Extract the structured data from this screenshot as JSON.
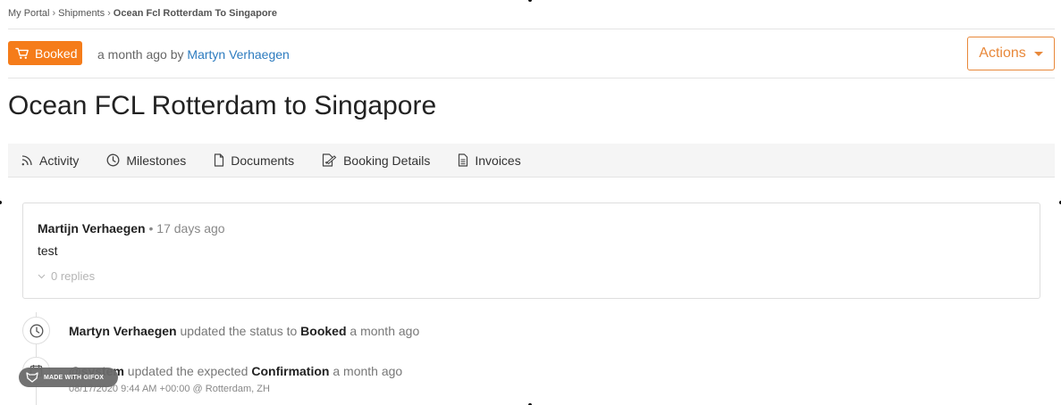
{
  "breadcrumb": {
    "items": [
      "My Portal",
      "Shipments"
    ],
    "separator": "›",
    "current": "Ocean Fcl Rotterdam To Singapore"
  },
  "status": {
    "label": "Booked",
    "icon": "cart-icon",
    "color": "#f57c1a"
  },
  "meta": {
    "prefix": "a month ago by",
    "author": "Martyn Verhaegen"
  },
  "actions": {
    "label": "Actions",
    "color": "#e8883a"
  },
  "title": "Ocean FCL Rotterdam to Singapore",
  "tabs": [
    {
      "label": "Activity",
      "icon": "rss-icon"
    },
    {
      "label": "Milestones",
      "icon": "clock-icon"
    },
    {
      "label": "Documents",
      "icon": "file-icon"
    },
    {
      "label": "Booking Details",
      "icon": "edit-document-icon"
    },
    {
      "label": "Invoices",
      "icon": "invoice-icon"
    }
  ],
  "comment": {
    "author": "Martijn Verhaegen",
    "separator": "•",
    "time": "17 days ago",
    "body": "test",
    "replies": "0 replies"
  },
  "timeline": [
    {
      "icon": "clock-icon",
      "actor": "Martyn Verhaegen",
      "action": "updated the status to",
      "target": "Booked",
      "time": "a month ago"
    },
    {
      "icon": "calendar-icon",
      "actor": "@system",
      "action": "updated the expected",
      "target": "Confirmation",
      "time": "a month ago",
      "detail": "08/17/2020 9:44 AM +00:00 @ Rotterdam, ZH"
    }
  ],
  "watermark": {
    "label": "MADE WITH GIFOX"
  }
}
